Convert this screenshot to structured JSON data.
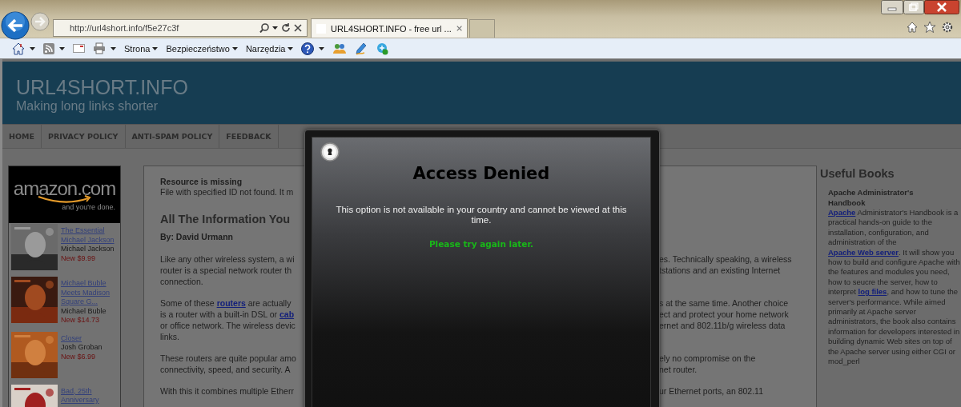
{
  "address_bar": {
    "value": "http://url4short.info/f5e27c3f"
  },
  "tabs": [
    {
      "label": "URL4SHORT.INFO - free url ...",
      "selected": true
    }
  ],
  "command_bar": {
    "menus": [
      "Strona",
      "Bezpieczeństwo",
      "Narzędzia"
    ]
  },
  "site": {
    "title": "URL4SHORT.INFO",
    "tagline": "Making long links shorter",
    "nav": [
      "HOME",
      "PRIVACY POLICY",
      "ANTI-SPAM POLICY",
      "FEEDBACK"
    ],
    "amazon_widget": {
      "logo": "amazon.com",
      "slogan": "and you're done.",
      "items": [
        {
          "title": "The Essential Michael Jackson",
          "artist": "Michael Jackson",
          "price": "New $9.99"
        },
        {
          "title": "Michael Buble Meets Madison Square G...",
          "artist": "Michael Buble",
          "price": "New $14.73"
        },
        {
          "title": "Closer",
          "artist": "Josh Groban",
          "price": "New $6.99"
        },
        {
          "title": "Bad, 25th Anniversary"
        }
      ]
    },
    "article": {
      "notice_title": "Resource is missing",
      "notice_text": "File with specified ID not found. It m",
      "heading": "All The Information You",
      "byline": "By: David Urmann",
      "paragraphs": [
        [
          {
            "left": "Like any other wireless system, a wi",
            "right": "es. Technically speaking, a wireless"
          },
          {
            "left": "router is a special network router th",
            "right": "tstations and an existing Internet"
          },
          {
            "left": "connection."
          }
        ],
        [
          {
            "left": "Some of these **routers** are actually",
            "right": "s at the same time. Another choice"
          },
          {
            "left": "is a router with a built-in DSL or **cab**",
            "right": "ect and protect your home network"
          },
          {
            "left": "or office network. The wireless devic",
            "right": "ernet and 802.11b/g wireless data"
          },
          {
            "left": "links."
          }
        ],
        [
          {
            "left": "These routers are quite popular amo",
            "right": "ely no compromise on the"
          },
          {
            "left": "connectivity, speed, and security. A",
            "right": "net router."
          }
        ],
        [
          {
            "left": "With this it combines multiple Etherr",
            "right": "ur Ethernet ports, an 802.11"
          }
        ]
      ]
    },
    "sidebar": {
      "heading": "Useful Books",
      "books": [
        {
          "title": "Apache Administrator's Handbook",
          "description": "**Apache** Administrator's Handbook is a practical hands-on guide to the installation, configuration, and administration of the **Apache Web server**. It will show you how to build and configure Apache with the features and modules you need, how to seucre the server, how to interpret **log files**, and how to tune the server's performance. While aimed primarily at Apache server administrators, the book also contains information for developers interested in building dynamic Web sites on top of the Apache server using either CGI or mod_perl"
        }
      ]
    }
  },
  "dialog": {
    "title": "Access Denied",
    "message": "This option is not available in your country and cannot be viewed at this time.",
    "hint": "Please try again later."
  }
}
